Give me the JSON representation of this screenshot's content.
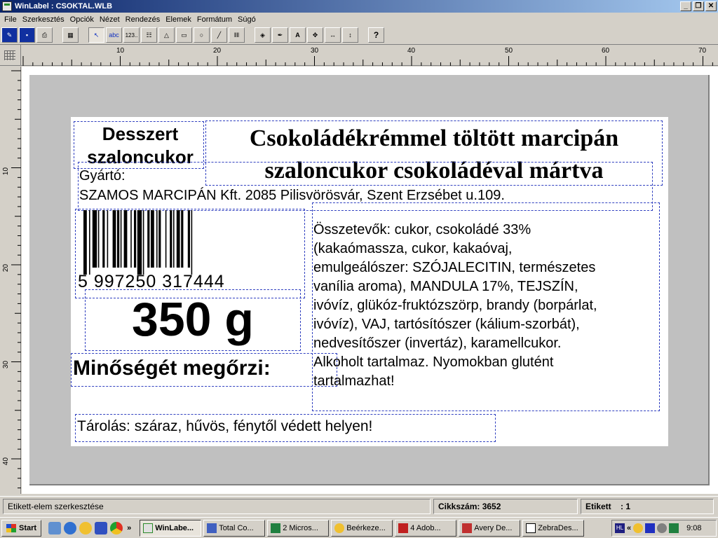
{
  "window": {
    "title": "WinLabel : CSOKTAL.WLB"
  },
  "menu": [
    "File",
    "Szerkesztés",
    "Opciók",
    "Nézet",
    "Rendezés",
    "Elemek",
    "Formátum",
    "Súgó"
  ],
  "toolbar": {
    "text_tool": "abc",
    "number_tool": "123..",
    "help": "?"
  },
  "ruler": {
    "h_ticks": [
      "10",
      "20",
      "30",
      "40",
      "50",
      "60",
      "70"
    ],
    "v_ticks": [
      "10",
      "20",
      "30",
      "40"
    ]
  },
  "label": {
    "product_type": [
      "Desszert",
      "szaloncukor"
    ],
    "product_name": [
      "Csokoládékrémmel töltött marcipán",
      "szaloncukor csokoládéval mártva"
    ],
    "manufacturer_label": "Gyártó:",
    "manufacturer": "SZAMOS MARCIPÁN Kft. 2085 Pilisvörösvár, Szent Erzsébet u.109.",
    "barcode_digits": "5 997250 317444",
    "weight": "350 g",
    "best_before": "Minőségét megőrzi:",
    "ingredients": [
      "Összetevők: cukor, csokoládé 33%",
      "(kakaómassza, cukor, kakaóvaj,",
      "emulgeálószer: SZÓJALECITIN, természetes",
      "vanília aroma), MANDULA 17%, TEJSZÍN,",
      "ivóvíz, glükóz-fruktózszörp, brandy (borpárlat,",
      "ivóvíz), VAJ, tartósítószer (kálium-szorbát),",
      "nedvesítőszer (invertáz), karamellcukor.",
      "Alkoholt tartalmaz. Nyomokban glutént",
      "tartalmazhat!"
    ],
    "storage": "Tárolás: száraz, hűvös, fénytől védett helyen!"
  },
  "status": {
    "mode": "Etikett-elem szerkesztése",
    "item_no": "Cikkszám: 3652",
    "label_no": "Etikett    : 1"
  },
  "taskbar": {
    "start": "Start",
    "tasks": [
      "WinLabe...",
      "Total Co...",
      "2 Micros...",
      "Beérkeze...",
      "4 Adob...",
      "Avery De...",
      "ZebraDes..."
    ],
    "chevron": "»",
    "clock": "9:08",
    "tray_hl": "HL",
    "tray_arrows": "«"
  },
  "colors": {
    "title_start": "#0a246a",
    "title_end": "#a6caf0",
    "selection": "#3040c0"
  }
}
